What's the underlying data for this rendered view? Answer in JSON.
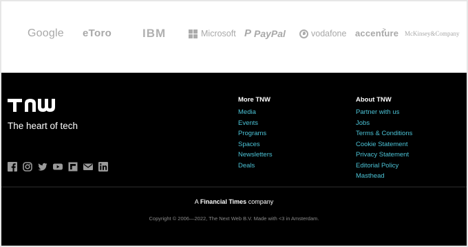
{
  "partners": {
    "google": "Google",
    "etoro": "eToro",
    "ibm": "IBM",
    "microsoft": "Microsoft",
    "paypal": "PayPal",
    "vodafone": "vodafone",
    "accenture": "accenture",
    "mckinsey": "McKinsey&Company"
  },
  "brand": {
    "logo_text": "TNW",
    "tagline": "The heart of tech"
  },
  "social_icons": [
    "facebook-icon",
    "instagram-icon",
    "twitter-icon",
    "youtube-icon",
    "flipboard-icon",
    "email-icon",
    "linkedin-icon"
  ],
  "more": {
    "heading": "More TNW",
    "links": [
      "Media",
      "Events",
      "Programs",
      "Spaces",
      "Newsletters",
      "Deals"
    ]
  },
  "about": {
    "heading": "About TNW",
    "links": [
      "Partner with us",
      "Jobs",
      "Terms & Conditions",
      "Cookie Statement",
      "Privacy Statement",
      "Editorial Policy",
      "Masthead"
    ]
  },
  "footer": {
    "prefix": "A",
    "ft_name": "Financial Times",
    "suffix": "company",
    "copyright": "Copyright © 2006—2022, The Next Web B.V. Made with <3 in Amsterdam."
  },
  "colors": {
    "background": "#000000",
    "link": "#4cc3d6",
    "partner_logo": "#a8a8a8"
  }
}
